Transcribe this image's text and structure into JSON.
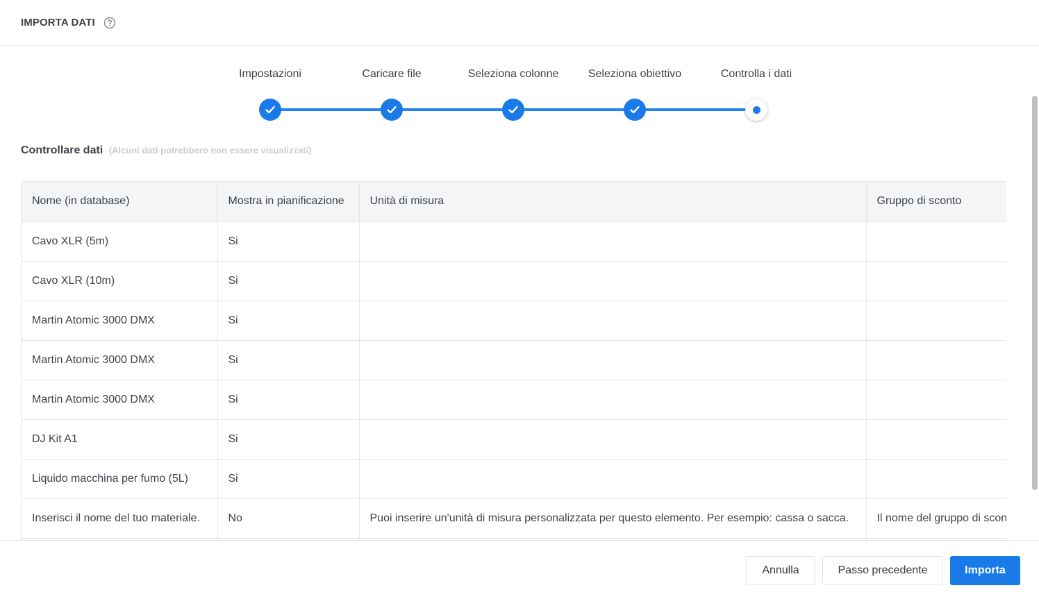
{
  "header": {
    "title": "IMPORTA DATI",
    "help_icon": "help-circle-icon"
  },
  "stepper": {
    "steps": [
      {
        "label": "Impostazioni",
        "status": "done"
      },
      {
        "label": "Caricare file",
        "status": "done"
      },
      {
        "label": "Seleziona colonne",
        "status": "done"
      },
      {
        "label": "Seleziona obiettivo",
        "status": "done"
      },
      {
        "label": "Controlla i dati",
        "status": "current"
      }
    ],
    "accent_color": "#1a7ae8"
  },
  "section": {
    "title": "Controllare dati",
    "note": "(Alcuni dati potrebbero non essere visualizzati)"
  },
  "table": {
    "columns": [
      "Nome (in database)",
      "Mostra in pianificazione",
      "Unità di misura",
      "Gruppo di sconto"
    ],
    "rows": [
      [
        "Cavo XLR (5m)",
        "Si",
        "",
        ""
      ],
      [
        "Cavo XLR (10m)",
        "Si",
        "",
        ""
      ],
      [
        "Martin Atomic 3000 DMX",
        "Si",
        "",
        ""
      ],
      [
        "Martin Atomic 3000 DMX",
        "Si",
        "",
        ""
      ],
      [
        "Martin Atomic 3000 DMX",
        "Si",
        "",
        ""
      ],
      [
        "DJ Kit A1",
        "Si",
        "",
        ""
      ],
      [
        "Liquido macchina per fumo (5L)",
        "Si",
        "",
        ""
      ],
      [
        "Inserisci il nome del tuo materiale.",
        "No",
        "Puoi inserire un'unità di misura personalizzata per questo elemento. Per esempio: cassa o sacca.",
        "Il nome del gruppo di sconto"
      ],
      [
        "",
        "",
        "",
        ""
      ]
    ]
  },
  "footer": {
    "cancel_label": "Annulla",
    "previous_label": "Passo precedente",
    "import_label": "Importa"
  }
}
